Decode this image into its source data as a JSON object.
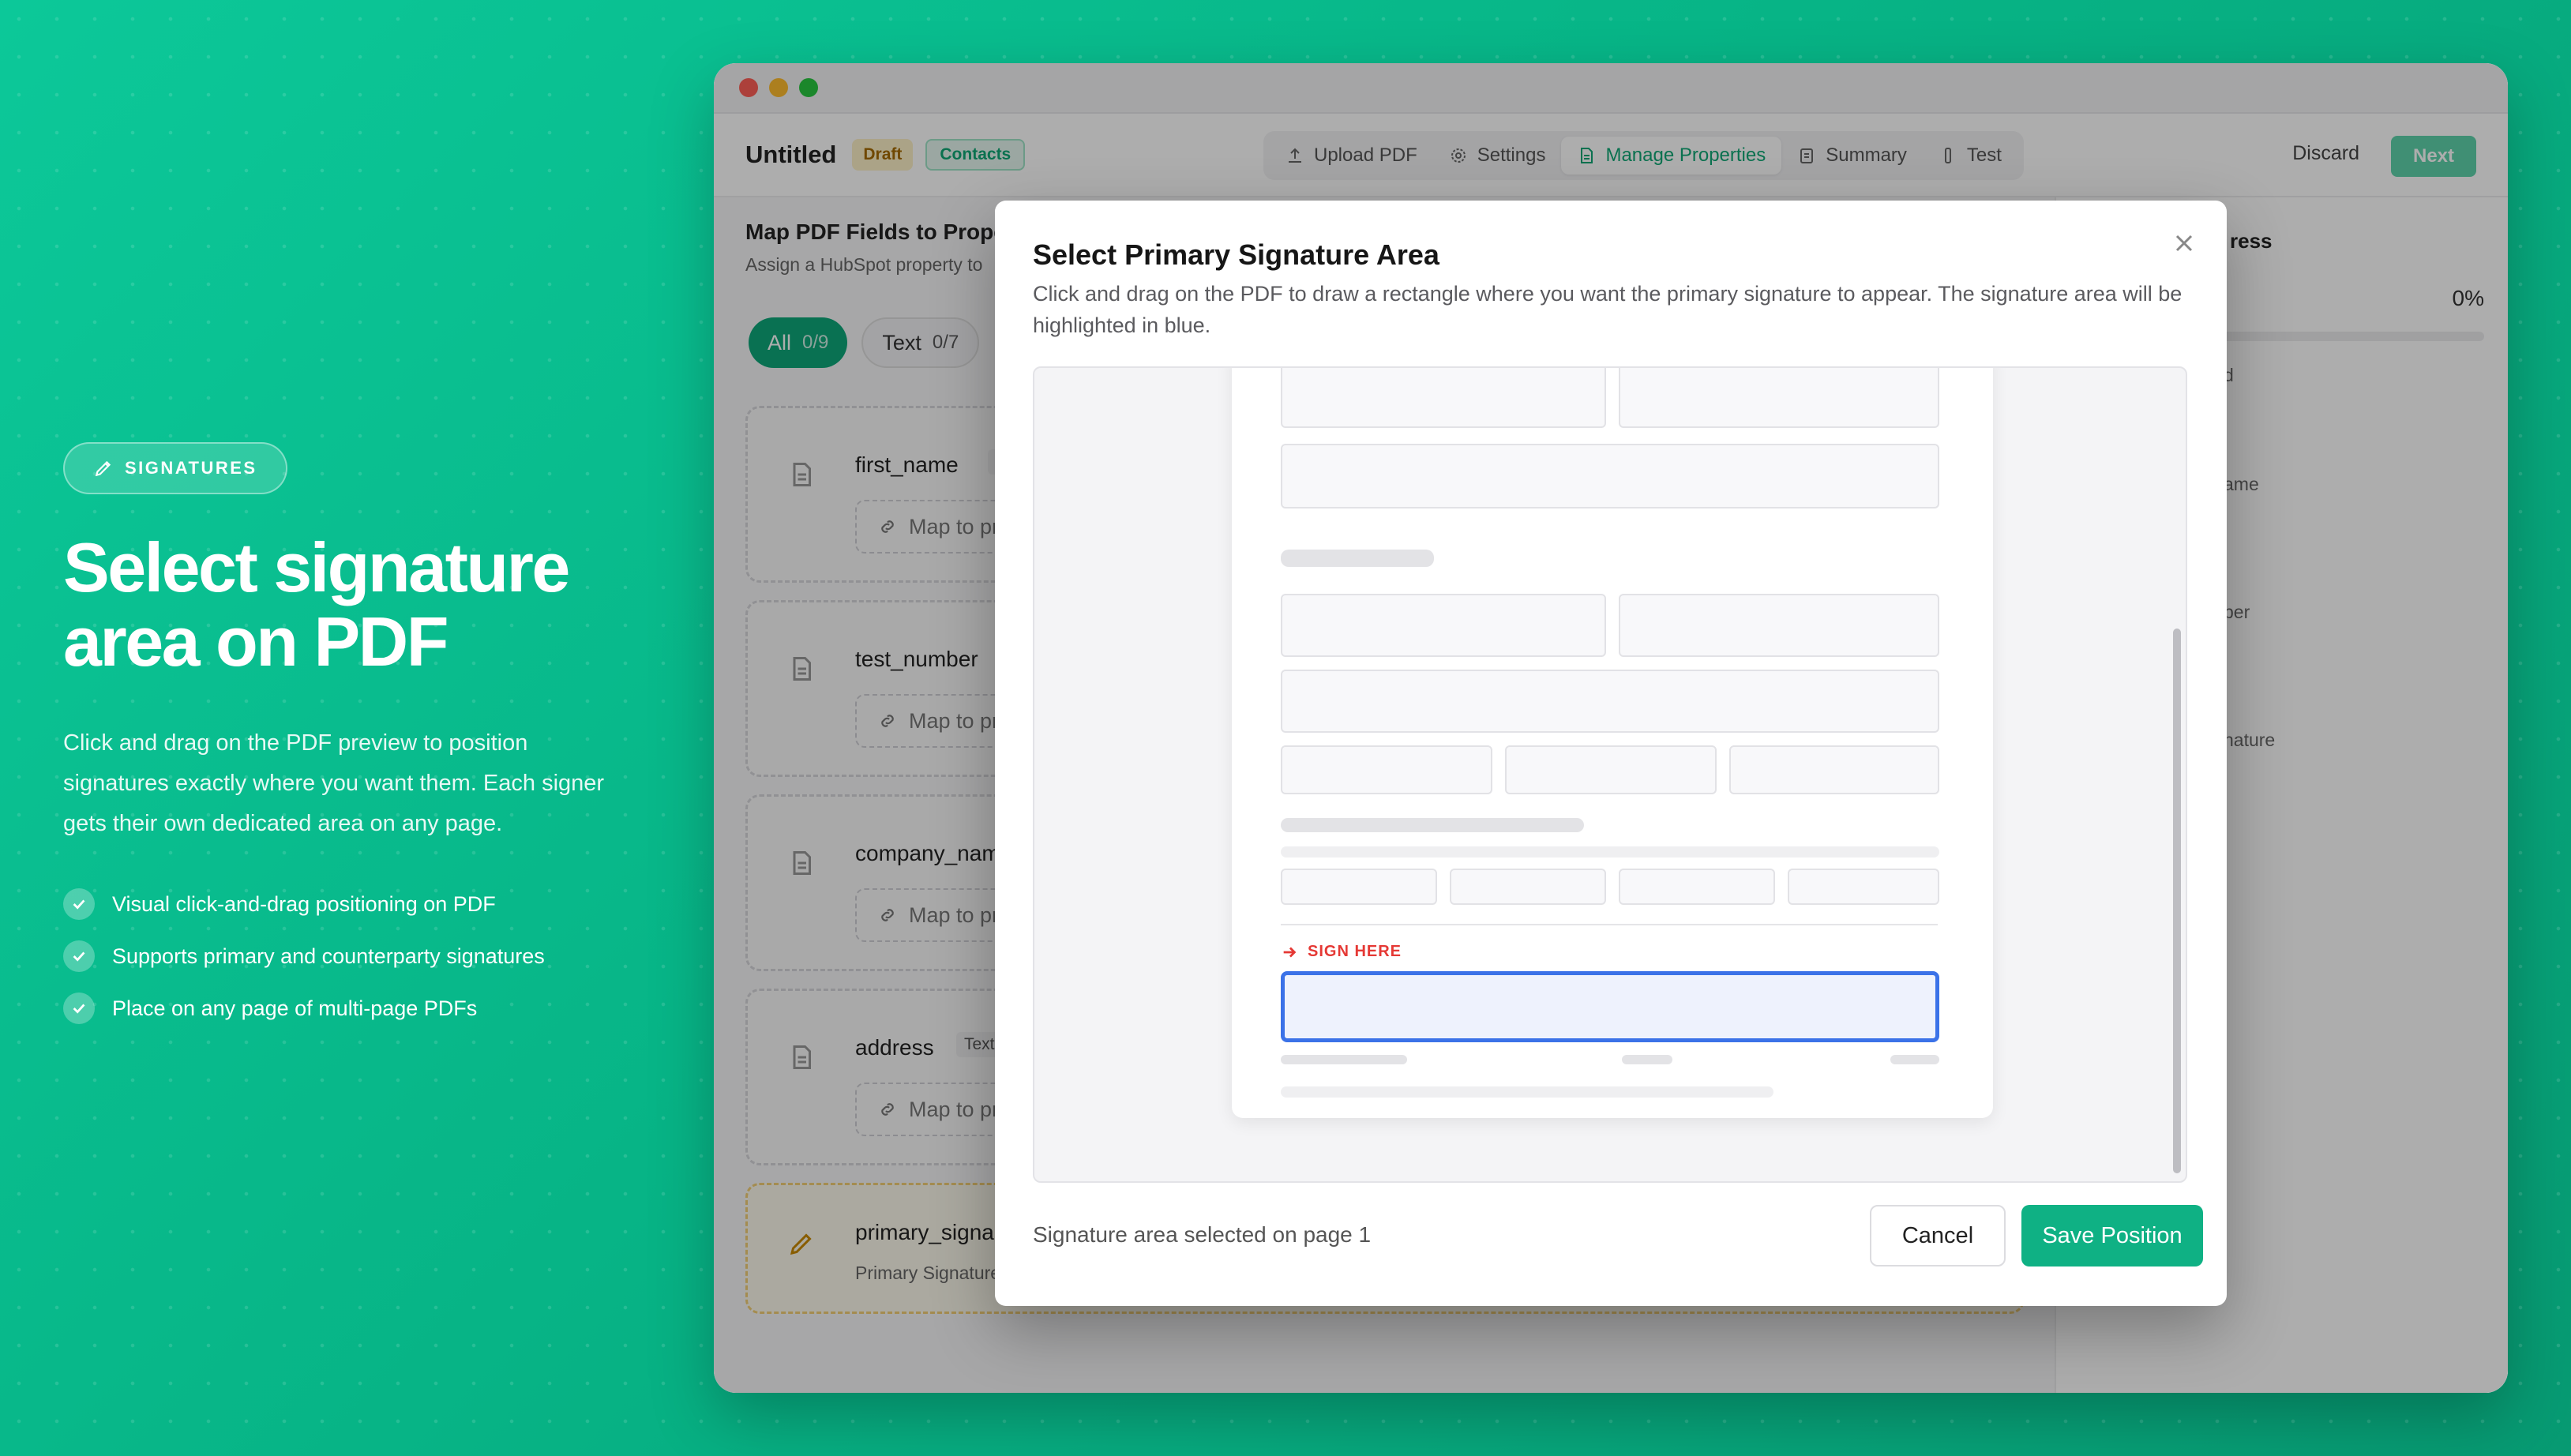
{
  "marketing": {
    "badge": "SIGNATURES",
    "title_line1": "Select signature",
    "title_line2": "area on PDF",
    "description": "Click and drag on the PDF preview to position signatures exactly where you want them. Each signer gets their own dedicated area on any page.",
    "bullets": [
      "Visual click-and-drag positioning on PDF",
      "Supports primary and counterparty signatures",
      "Place on any page of multi-page PDFs"
    ]
  },
  "toolbar": {
    "doc_title": "Untitled",
    "draft_badge": "Draft",
    "object_badge": "Contacts",
    "tabs": [
      "Upload PDF",
      "Settings",
      "Manage Properties",
      "Summary",
      "Test"
    ],
    "active_tab": "Manage Properties",
    "discard_label": "Discard",
    "next_label": "Next"
  },
  "mapping": {
    "heading": "Map PDF Fields to Prope",
    "subheading": "Assign a HubSpot property to",
    "filters": [
      {
        "label": "All",
        "count": "0/9"
      },
      {
        "label": "Text",
        "count": "0/7"
      }
    ],
    "fields": [
      {
        "name": "first_name",
        "type": "Te",
        "action": "Map to pr"
      },
      {
        "name": "test_number",
        "type": "",
        "action": "Map to pr"
      },
      {
        "name": "company_nam",
        "type": "",
        "action": "Map to pr"
      },
      {
        "name": "address",
        "type": "Text",
        "action": "Map to pr"
      }
    ],
    "signature_field": {
      "name": "primary_signa",
      "sub": "Primary Signature"
    }
  },
  "right_panel": {
    "title": "ress",
    "progress": "0%",
    "progress_value": 0,
    "partial_1": "d",
    "items": [
      "ame",
      "ber",
      "nature"
    ]
  },
  "modal": {
    "title": "Select Primary Signature Area",
    "description": "Click and drag on the PDF to draw a rectangle where you want the primary signature to appear. The signature area will be highlighted in blue.",
    "sign_here": "SIGN HERE",
    "status": "Signature area selected on page 1",
    "cancel_label": "Cancel",
    "save_label": "Save Position"
  },
  "colors": {
    "brand": "#0fb184",
    "selection": "#3b72e8",
    "sign_here": "#e53935"
  }
}
